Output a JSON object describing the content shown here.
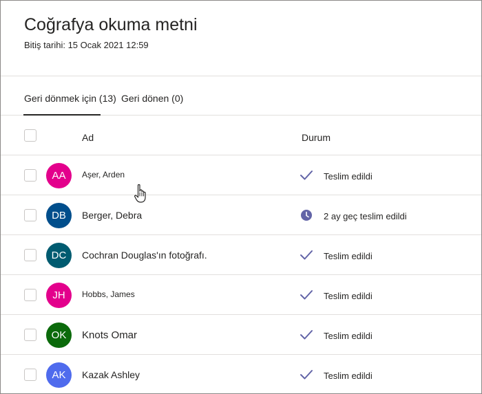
{
  "assignment": {
    "title": "Coğrafya okuma metni",
    "due": "Bitiş tarihi: 15 Ocak 2021 12:59"
  },
  "tabs": [
    {
      "label": "Geri dönmek için (13)",
      "active": true
    },
    {
      "label": "Geri dönen (0)",
      "active": false
    }
  ],
  "columns": {
    "name": "Ad",
    "status": "Durum"
  },
  "students": [
    {
      "initials": "AA",
      "name": "Aşer, Arden",
      "color": "#e3008c",
      "status": "Teslim edildi",
      "status_icon": "checkmark-icon"
    },
    {
      "initials": "DB",
      "name": "Berger, Debra",
      "color": "#004e8c",
      "status": "2 ay geç teslim edildi",
      "status_icon": "clock-icon"
    },
    {
      "initials": "DC",
      "name": "Cochran Douglas'ın fotoğrafı.",
      "color": "#005b70",
      "status": "Teslim edildi",
      "status_icon": "checkmark-icon"
    },
    {
      "initials": "JH",
      "name": "Hobbs, James",
      "color": "#e3008c",
      "status": "Teslim edildi",
      "status_icon": "checkmark-icon"
    },
    {
      "initials": "OK",
      "name": "Knots Omar",
      "color": "#0b6a0b",
      "status": "Teslim edildi",
      "status_icon": "checkmark-icon"
    },
    {
      "initials": "AK",
      "name": "Kazak Ashley",
      "color": "#4f6bed",
      "status": "Teslim edildi",
      "status_icon": "checkmark-icon"
    }
  ],
  "colors": {
    "accent": "#6264a7",
    "divider": "#e1dfdd"
  }
}
